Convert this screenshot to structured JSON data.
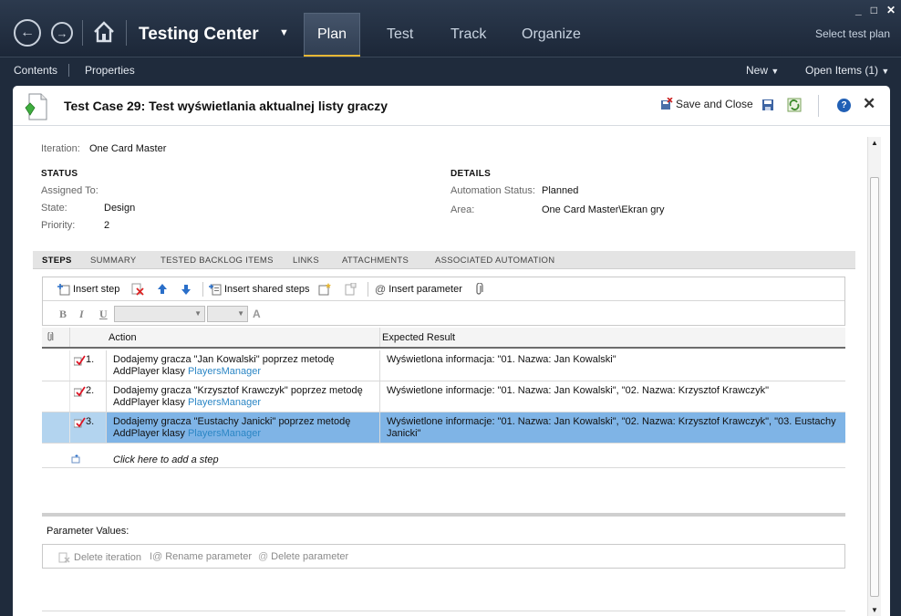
{
  "window_controls": {
    "minimize": "_",
    "maximize": "□",
    "close": "✕"
  },
  "nav": {
    "back_glyph": "←",
    "forward_glyph": "→",
    "app_title": "Testing Center",
    "tabs": [
      {
        "label": "Plan"
      },
      {
        "label": "Test"
      },
      {
        "label": "Track"
      },
      {
        "label": "Organize"
      }
    ],
    "select_plan": "Select test plan"
  },
  "subbar": {
    "contents": "Contents",
    "properties": "Properties",
    "new": "New",
    "open_items": "Open Items (1)"
  },
  "doc": {
    "title": "Test Case 29: Test wyświetlania aktualnej listy graczy",
    "save_close": "Save and Close",
    "help": "?",
    "close": "✕",
    "iteration_label": "Iteration:",
    "iteration_value": "One Card Master",
    "status": {
      "heading": "STATUS",
      "assigned_label": "Assigned To:",
      "assigned_value": "",
      "state_label": "State:",
      "state_value": "Design",
      "priority_label": "Priority:",
      "priority_value": "2"
    },
    "details": {
      "heading": "DETAILS",
      "automation_label": "Automation Status:",
      "automation_value": "Planned",
      "area_label": "Area:",
      "area_value": "One Card Master\\Ekran gry"
    },
    "tabs": [
      "STEPS",
      "SUMMARY",
      "TESTED BACKLOG ITEMS",
      "LINKS",
      "ATTACHMENTS",
      "ASSOCIATED AUTOMATION"
    ]
  },
  "toolbar": {
    "insert_step": "Insert step",
    "insert_shared_steps": "Insert shared steps",
    "insert_parameter": "Insert parameter",
    "bold": "B",
    "italic": "I",
    "underline": "U"
  },
  "grid": {
    "col_action": "Action",
    "col_expected": "Expected Result",
    "steps": [
      {
        "num": "1.",
        "action_line1": "Dodajemy gracza \"Jan Kowalski\" poprzez metodę",
        "action_line2": "AddPlayer klasy ",
        "action_link": "PlayersManager",
        "expected": "Wyświetlona informacja: \"01. Nazwa: Jan Kowalski\""
      },
      {
        "num": "2.",
        "action_line1": "Dodajemy gracza \"Krzysztof Krawczyk\" poprzez metodę",
        "action_line2": "AddPlayer klasy ",
        "action_link": "PlayersManager",
        "expected": "Wyświetlone informacje: \"01. Nazwa: Jan Kowalski\", \"02. Nazwa: Krzysztof Krawczyk\""
      },
      {
        "num": "3.",
        "action_line1": "Dodajemy gracza \"Eustachy Janicki\" poprzez metodę",
        "action_line2": "AddPlayer klasy ",
        "action_link": "PlayersManager",
        "expected": "Wyświetlone informacje: \"01. Nazwa: Jan Kowalski\", \"02. Nazwa: Krzysztof Krawczyk\", \"03. Eustachy Janicki\""
      }
    ],
    "add_step": "Click here to add a step"
  },
  "parameters": {
    "label": "Parameter Values:",
    "delete_iteration": "Delete iteration",
    "rename_parameter": "Rename parameter",
    "delete_parameter": "Delete parameter"
  },
  "colors": {
    "accent": "#e6b735",
    "selected_row": "#7fb4e6",
    "link": "#2b86c5"
  }
}
